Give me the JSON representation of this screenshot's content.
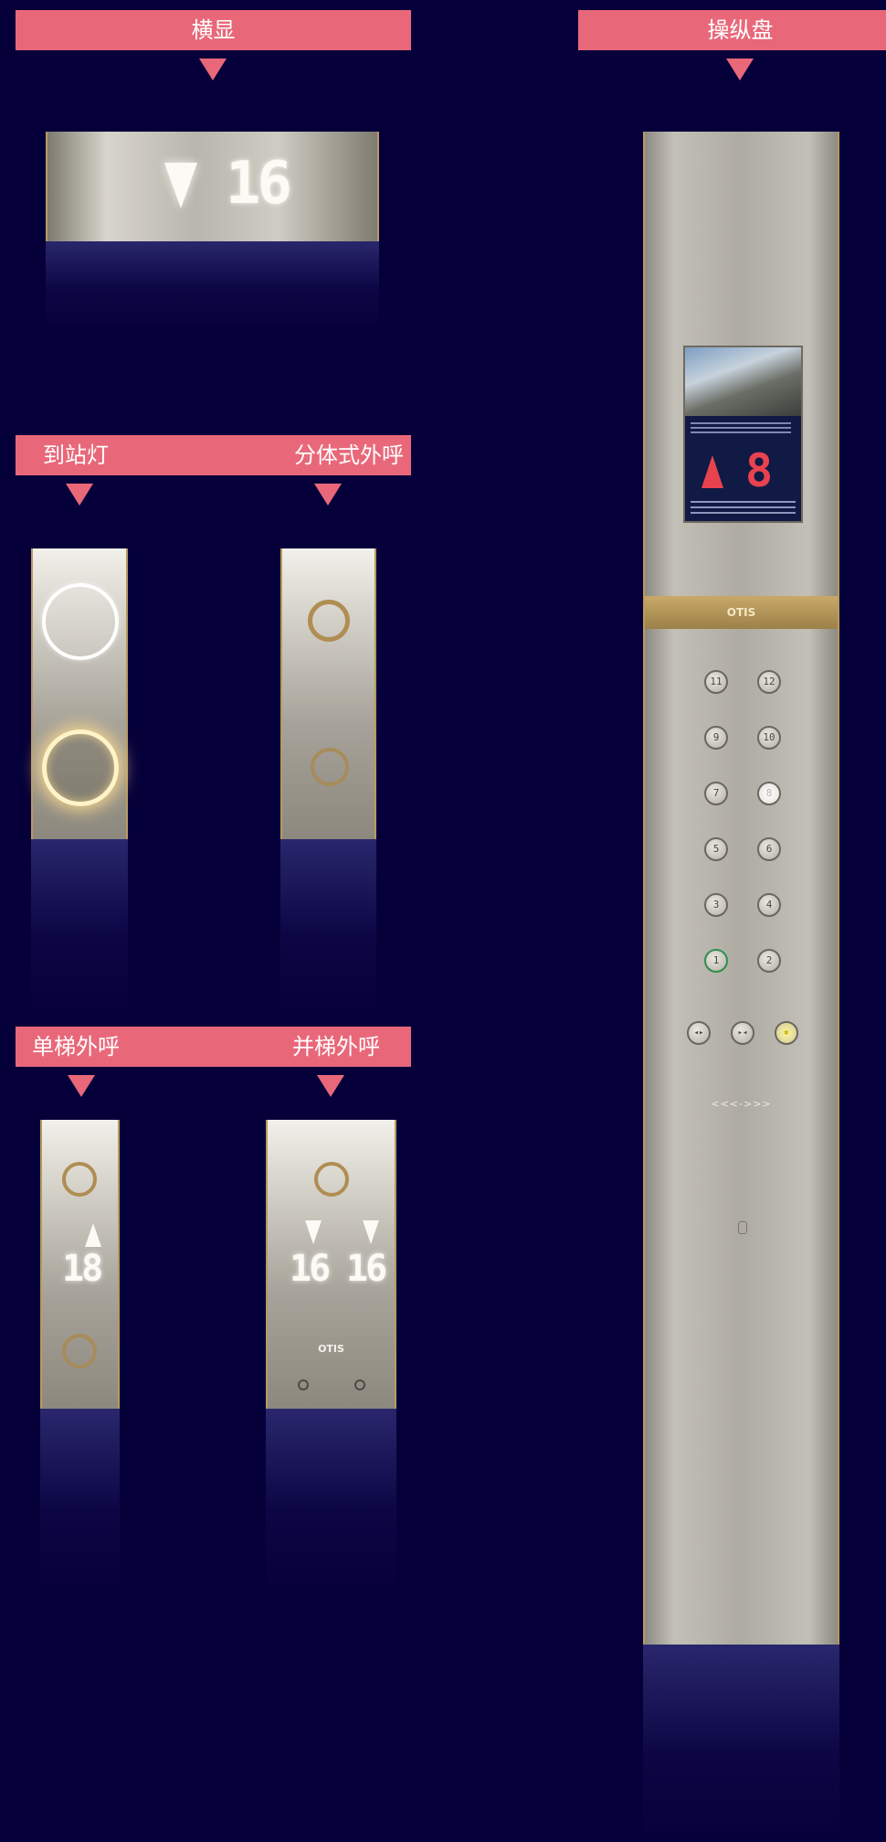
{
  "labels": {
    "horizontal_display": "横显",
    "control_panel": "操纵盘",
    "arrival_lantern": "到站灯",
    "split_hall_call": "分体式外呼",
    "single_hall_call": "单梯外呼",
    "duplex_hall_call": "并梯外呼"
  },
  "horizontal_display": {
    "direction": "down",
    "floor": "16"
  },
  "single_hall_call": {
    "direction": "up",
    "floor": "18"
  },
  "duplex_hall_call": {
    "left": {
      "direction": "down",
      "floor": "16"
    },
    "right": {
      "direction": "down",
      "floor": "16"
    },
    "brand": "OTIS"
  },
  "control_panel": {
    "brand": "OTIS",
    "screen_floor": "8",
    "screen_direction": "up",
    "floor_buttons": [
      "11",
      "12",
      "9",
      "10",
      "7",
      "8",
      "5",
      "6",
      "3",
      "4",
      "1",
      "2"
    ],
    "door_buttons": [
      "◂▸",
      "▸◂",
      "✱"
    ],
    "signal_text": "<<<->>>"
  },
  "colors": {
    "background": "#06003a",
    "label": "#e8687a",
    "accent_gold": "#b89a5e"
  }
}
